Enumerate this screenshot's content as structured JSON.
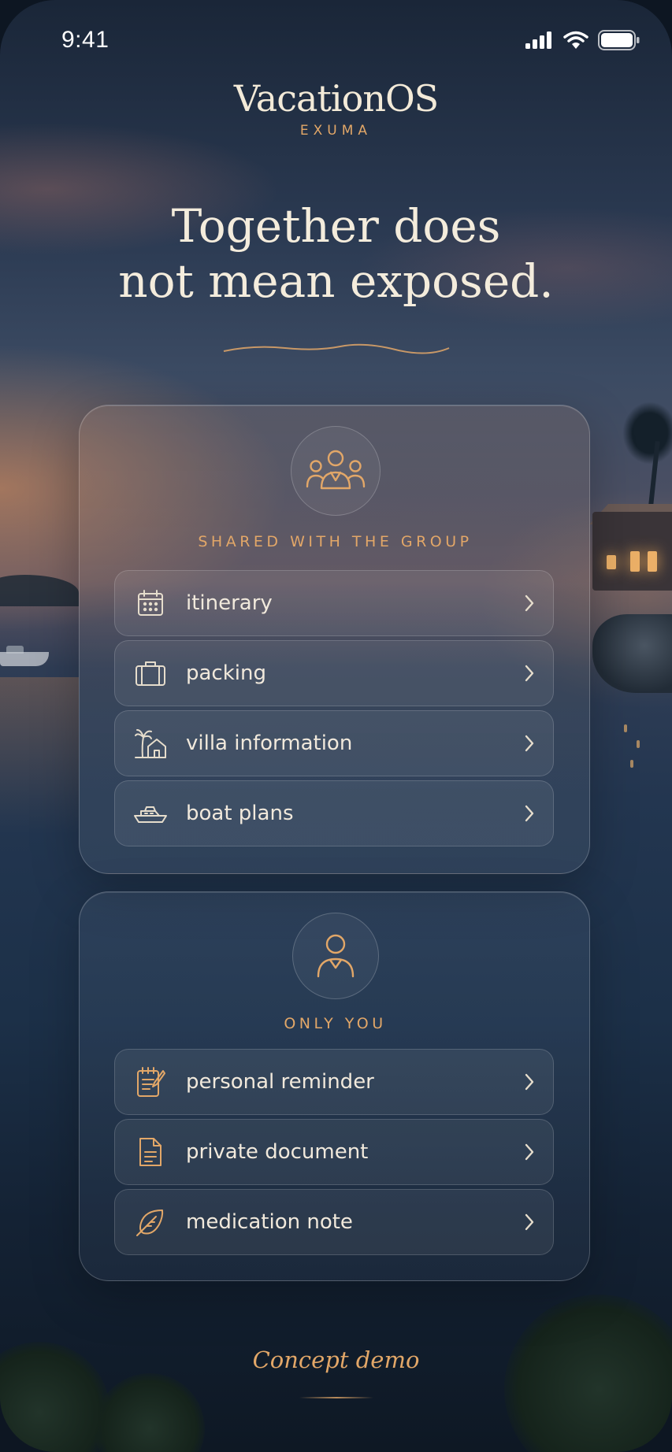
{
  "status_bar": {
    "time": "9:41",
    "icons": [
      "cellular-signal-icon",
      "wifi-icon",
      "battery-icon"
    ]
  },
  "header": {
    "app_name": "VacationOS",
    "location": "EXUMA"
  },
  "headline": {
    "line1": "Together does",
    "line2": "not mean exposed."
  },
  "shared_section": {
    "icon": "group-icon",
    "label": "SHARED WITH THE GROUP",
    "items": [
      {
        "label": "itinerary",
        "icon": "calendar-icon"
      },
      {
        "label": "packing",
        "icon": "suitcase-icon"
      },
      {
        "label": "villa information",
        "icon": "villa-icon"
      },
      {
        "label": "boat plans",
        "icon": "boat-icon"
      }
    ]
  },
  "private_section": {
    "icon": "person-icon",
    "label": "ONLY YOU",
    "items": [
      {
        "label": "personal reminder",
        "icon": "note-icon"
      },
      {
        "label": "private document",
        "icon": "document-icon"
      },
      {
        "label": "medication note",
        "icon": "leaf-icon"
      }
    ]
  },
  "footer": {
    "text": "Concept demo"
  },
  "colors": {
    "accent": "#e2a768",
    "text": "#f1e9dc"
  }
}
